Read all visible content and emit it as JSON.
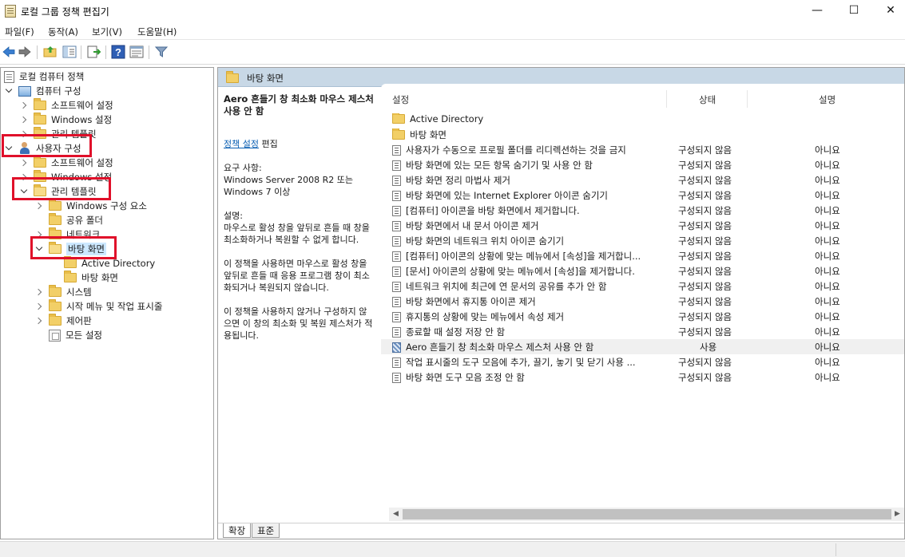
{
  "window": {
    "title": "로컬 그룹 정책 편집기",
    "minimize": "—",
    "maximize": "☐",
    "close": "✕"
  },
  "menu": {
    "items": [
      "파일(F)",
      "동작(A)",
      "보기(V)",
      "도움말(H)"
    ]
  },
  "toolbar": {
    "icons": [
      "back-arrow-icon",
      "forward-arrow-icon",
      "up-folder-icon",
      "show-hide-tree-icon",
      "export-list-icon",
      "help-icon",
      "properties-icon",
      "filter-icon"
    ]
  },
  "tree": {
    "root": "로컬 컴퓨터 정책",
    "computer_config": "컴퓨터 구성",
    "cc_software": "소프트웨어 설정",
    "cc_windows": "Windows 설정",
    "cc_admin": "관리 템플릿",
    "user_config": "사용자 구성",
    "uc_software": "소프트웨어 설정",
    "uc_windows": "Windows 설정",
    "uc_admin": "관리 템플릿",
    "windows_components": "Windows 구성 요소",
    "shared_folders": "공유 폴더",
    "network": "네트워크",
    "desktop": "바탕 화면",
    "active_directory": "Active Directory",
    "desktop_sub": "바탕 화면",
    "system": "시스템",
    "start_menu": "시작 메뉴 및 작업 표시줄",
    "control_panel": "제어판",
    "all_settings": "모든 설정"
  },
  "right": {
    "header_title": "바탕 화면",
    "desc": {
      "title": "Aero 흔들기 창 최소화 마우스 제스처 사용 안 함",
      "policy_link": "정책 설정",
      "edit": " 편집",
      "requirement_label": "요구 사항:",
      "requirement": "Windows Server 2008 R2 또는 Windows 7 이상",
      "desc_label": "설명:",
      "desc1": "마우스로 활성 창을 앞뒤로 흔들 때 창을 최소화하거나 복원할 수 없게 합니다.",
      "desc2": "이 정책을 사용하면 마우스로 활성 창을 앞뒤로 흔들 때 응용 프로그램 창이 최소화되거나 복원되지 않습니다.",
      "desc3": "이 정책을 사용하지 않거나 구성하지 않으면 이 창의 최소화 및 복원 제스처가 적용됩니다."
    },
    "columns": {
      "setting": "설정",
      "state": "상태",
      "note": "설명"
    },
    "rows": [
      {
        "name": "Active Directory",
        "state": "",
        "note": "",
        "kind": "folder"
      },
      {
        "name": "바탕 화면",
        "state": "",
        "note": "",
        "kind": "folder"
      },
      {
        "name": "사용자가 수동으로 프로필 폴더를 리디렉션하는 것을 금지",
        "state": "구성되지 않음",
        "note": "아니요",
        "kind": "setting"
      },
      {
        "name": "바탕 화면에 있는 모든 항목 숨기기 및 사용 안 함",
        "state": "구성되지 않음",
        "note": "아니요",
        "kind": "setting"
      },
      {
        "name": "바탕 화면 정리 마법사 제거",
        "state": "구성되지 않음",
        "note": "아니요",
        "kind": "setting"
      },
      {
        "name": "바탕 화면에 있는 Internet Explorer 아이콘 숨기기",
        "state": "구성되지 않음",
        "note": "아니요",
        "kind": "setting"
      },
      {
        "name": "[컴퓨터] 아이콘을 바탕 화면에서 제거합니다.",
        "state": "구성되지 않음",
        "note": "아니요",
        "kind": "setting"
      },
      {
        "name": "바탕 화면에서 내 문서 아이콘 제거",
        "state": "구성되지 않음",
        "note": "아니요",
        "kind": "setting"
      },
      {
        "name": "바탕 화면의 네트워크 위치 아이콘 숨기기",
        "state": "구성되지 않음",
        "note": "아니요",
        "kind": "setting"
      },
      {
        "name": "[컴퓨터] 아이콘의 상황에 맞는 메뉴에서 [속성]을 제거합니...",
        "state": "구성되지 않음",
        "note": "아니요",
        "kind": "setting"
      },
      {
        "name": "[문서] 아이콘의 상황에 맞는 메뉴에서 [속성]을 제거합니다.",
        "state": "구성되지 않음",
        "note": "아니요",
        "kind": "setting"
      },
      {
        "name": "네트워크 위치에 최근에 연 문서의 공유를 추가 안 함",
        "state": "구성되지 않음",
        "note": "아니요",
        "kind": "setting"
      },
      {
        "name": "바탕 화면에서 휴지통 아이콘 제거",
        "state": "구성되지 않음",
        "note": "아니요",
        "kind": "setting"
      },
      {
        "name": "휴지통의 상황에 맞는 메뉴에서 속성 제거",
        "state": "구성되지 않음",
        "note": "아니요",
        "kind": "setting"
      },
      {
        "name": "종료할 때 설정 저장 안 함",
        "state": "구성되지 않음",
        "note": "아니요",
        "kind": "setting"
      },
      {
        "name": "Aero 흔들기 창 최소화 마우스 제스처 사용 안 함",
        "state": "사용",
        "note": "아니요",
        "kind": "enabled"
      },
      {
        "name": "작업 표시줄의 도구 모음에 추가, 끌기, 놓기 및 닫기 사용 ...",
        "state": "구성되지 않음",
        "note": "아니요",
        "kind": "setting"
      },
      {
        "name": "바탕 화면 도구 모음 조정 안 함",
        "state": "구성되지 않음",
        "note": "아니요",
        "kind": "setting"
      }
    ],
    "tabs": [
      "확장",
      "표준"
    ]
  }
}
